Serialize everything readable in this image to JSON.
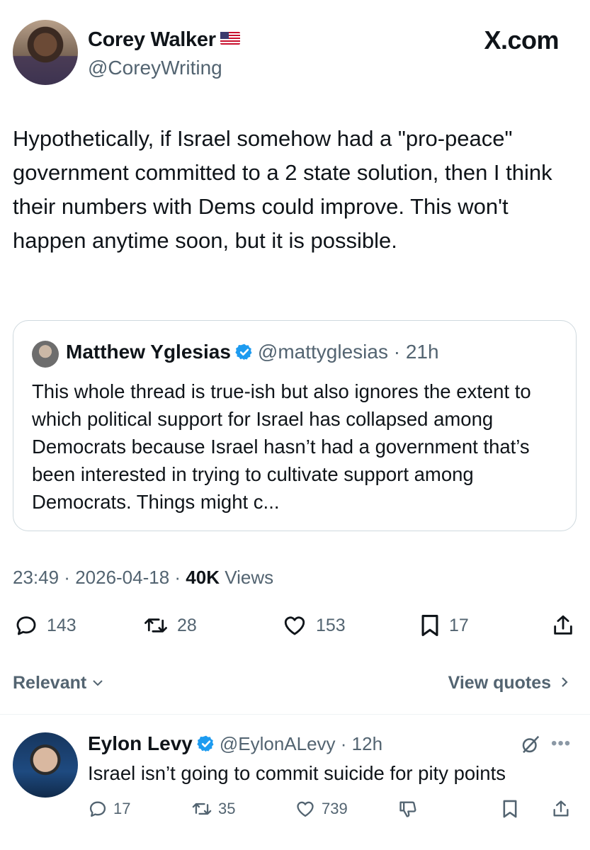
{
  "site_label": "X.com",
  "tweet": {
    "author_name": "Corey Walker",
    "author_handle": "@CoreyWriting",
    "text": "Hypothetically, if Israel somehow had a \"pro-peace\" government committed to a 2 state solution, then I think their numbers with Dems could improve. This won't happen anytime soon, but it is possible.",
    "time": "23:49",
    "date": "2026-04-18",
    "views_count": "40K",
    "views_label": "Views",
    "replies": "143",
    "reposts": "28",
    "likes": "153",
    "bookmarks": "17"
  },
  "quote": {
    "author_name": "Matthew Yglesias",
    "author_handle": "@mattyglesias",
    "age": "21h",
    "text": "This whole thread is true-ish but also ignores the extent to which political support for Israel has collapsed among Democrats because Israel hasn’t had a government that’s been interested in trying to cultivate support among Democrats. Things might c..."
  },
  "replies_bar": {
    "sort_label": "Relevant",
    "view_quotes_label": "View quotes"
  },
  "reply": {
    "author_name": "Eylon Levy",
    "author_handle": "@EylonALevy",
    "age": "12h",
    "text": "Israel isn’t going to commit suicide for pity points",
    "replies": "17",
    "reposts": "35",
    "likes": "739"
  },
  "colors": {
    "verified_blue": "#1d9bf0",
    "secondary_text": "#536471",
    "border": "#cfd9de"
  }
}
